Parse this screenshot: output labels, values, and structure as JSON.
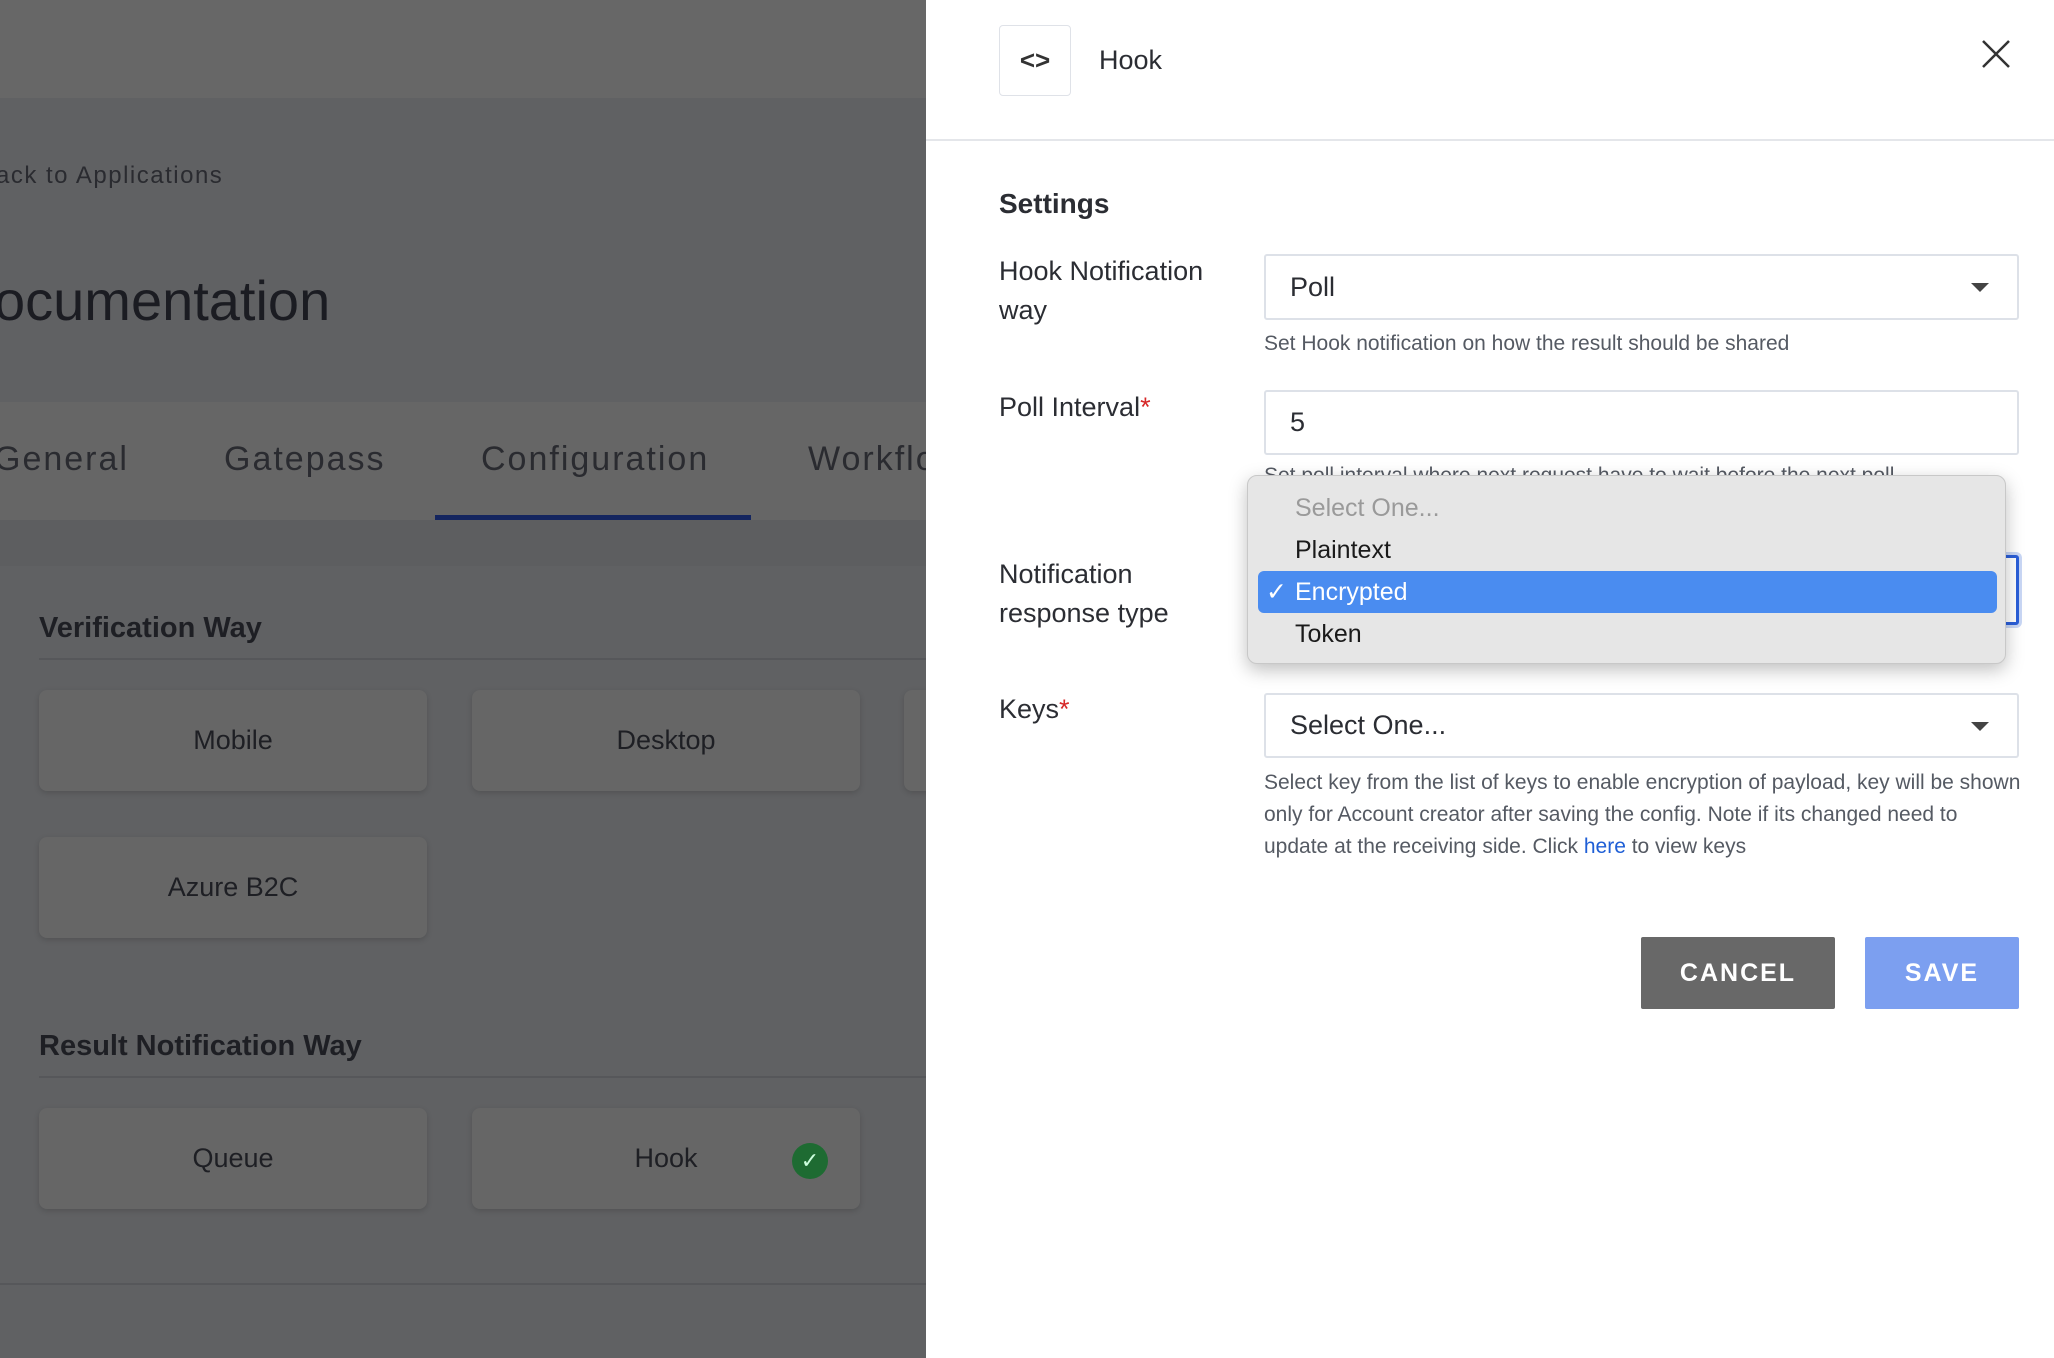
{
  "background": {
    "back_link": "ack to Applications",
    "page_title": "ocumentation",
    "tabs": [
      {
        "label": "General"
      },
      {
        "label": "Gatepass"
      },
      {
        "label": "Configuration",
        "active": true
      },
      {
        "label": "Workflo"
      }
    ],
    "verification_way": {
      "title": "Verification Way",
      "options": [
        "Mobile",
        "Desktop",
        "Azure B2C"
      ]
    },
    "result_notification_way": {
      "title": "Result Notification Way",
      "options": [
        "Queue",
        "Hook"
      ],
      "selected": "Hook"
    }
  },
  "drawer": {
    "title": "Hook",
    "icon": "code-icon",
    "section_title": "Settings",
    "hook_notification_way": {
      "label": "Hook Notification way",
      "value": "Poll",
      "help": "Set Hook notification on how the result should be shared"
    },
    "poll_interval": {
      "label": "Poll Interval",
      "required": "*",
      "value": "5",
      "help": "Set poll interval where next request have to wait before the next poll"
    },
    "notification_response_type": {
      "label": "Notification response type",
      "options": [
        "Select One...",
        "Plaintext",
        "Encrypted",
        "Token"
      ],
      "selected": "Encrypted",
      "check": "✓"
    },
    "keys": {
      "label": "Keys",
      "required": "*",
      "value": "Select One...",
      "help_before": "Select key from the list of keys to enable encryption of payload, key will be shown only for Account creator after saving the config. Note if its changed need to update at the receiving side. Click ",
      "help_link": "here",
      "help_after": " to view keys"
    },
    "cancel_label": "CANCEL",
    "save_label": "SAVE"
  },
  "colors": {
    "accent": "#4a8cf0",
    "save": "#7c9ff0",
    "cancel": "#686868",
    "link": "#1f5fd6",
    "success": "#1e6b32"
  }
}
